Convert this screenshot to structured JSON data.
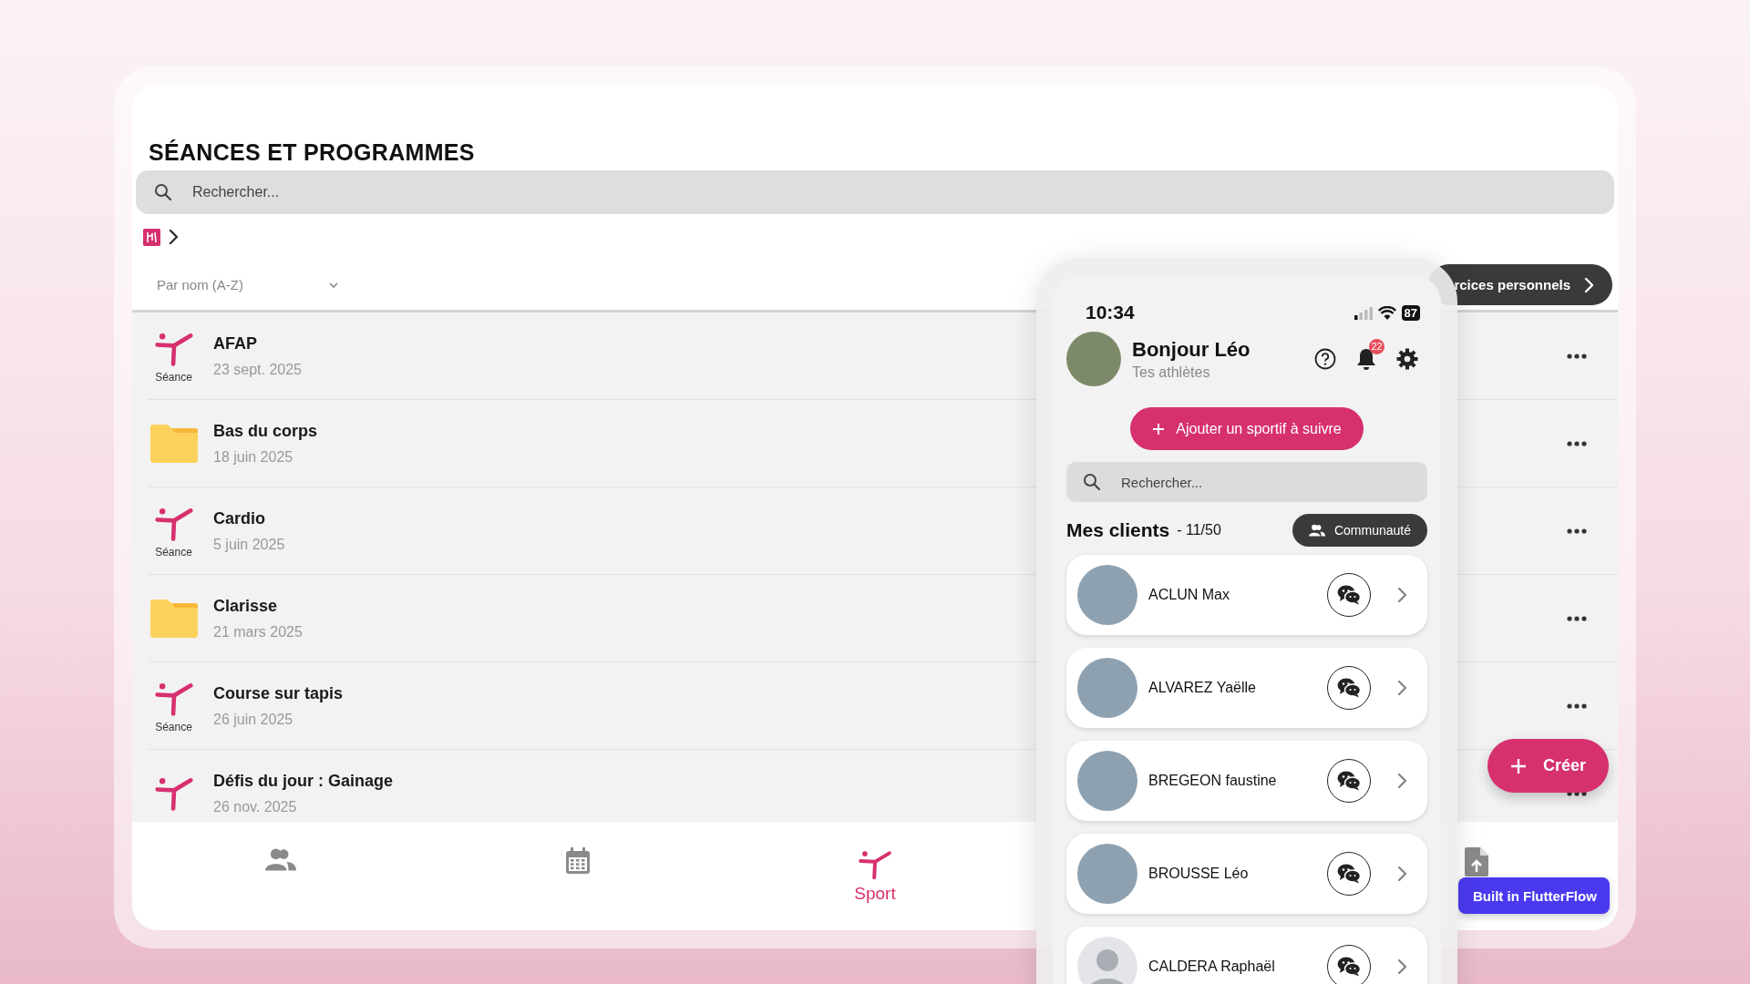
{
  "page": {
    "title": "SÉANCES ET PROGRAMMES",
    "search": {
      "placeholder": "Rechercher..."
    },
    "sort": {
      "value": "Par nom (A-Z)"
    },
    "personal_button": {
      "label": "rcices personnels"
    },
    "items": [
      {
        "kind": "seance",
        "name": "AFAP",
        "date": "23 sept. 2025",
        "icon_label": "Séance"
      },
      {
        "kind": "folder",
        "name": "Bas du corps",
        "date": "18 juin 2025"
      },
      {
        "kind": "seance",
        "name": "Cardio",
        "date": "5 juin 2025",
        "icon_label": "Séance"
      },
      {
        "kind": "folder",
        "name": "Clarisse",
        "date": "21 mars 2025"
      },
      {
        "kind": "seance",
        "name": "Course sur tapis",
        "date": "26 juin 2025",
        "icon_label": "Séance"
      },
      {
        "kind": "seance",
        "name": "Défis du jour : Gainage",
        "date": "26 nov. 2025"
      }
    ],
    "nav": [
      {
        "kind": "people",
        "selected": false
      },
      {
        "kind": "calendar",
        "selected": false
      },
      {
        "kind": "sport",
        "label": "Sport",
        "selected": true
      },
      {
        "kind": "file",
        "selected": false
      }
    ],
    "fab": {
      "label": "Créer"
    },
    "badge": {
      "label": "Built in FlutterFlow"
    }
  },
  "phone": {
    "time": "10:34",
    "battery": "87",
    "greeting": "Bonjour Léo",
    "subtitle": "Tes athlètes",
    "notifications": "22",
    "add_button": "Ajouter un sportif à suivre",
    "search": {
      "placeholder": "Rechercher..."
    },
    "clients_title": "Mes clients",
    "clients_count": "- 11/50",
    "community_button": "Communauté",
    "clients": [
      {
        "name": "ACLUN Max",
        "kind": "photo"
      },
      {
        "name": "ALVAREZ Yaëlle",
        "kind": "photo"
      },
      {
        "name": "BREGEON faustine",
        "kind": "photo"
      },
      {
        "name": "BROUSSE  Léo",
        "kind": "photo"
      },
      {
        "name": "CALDERA Raphaël",
        "kind": "silhouette"
      }
    ]
  }
}
